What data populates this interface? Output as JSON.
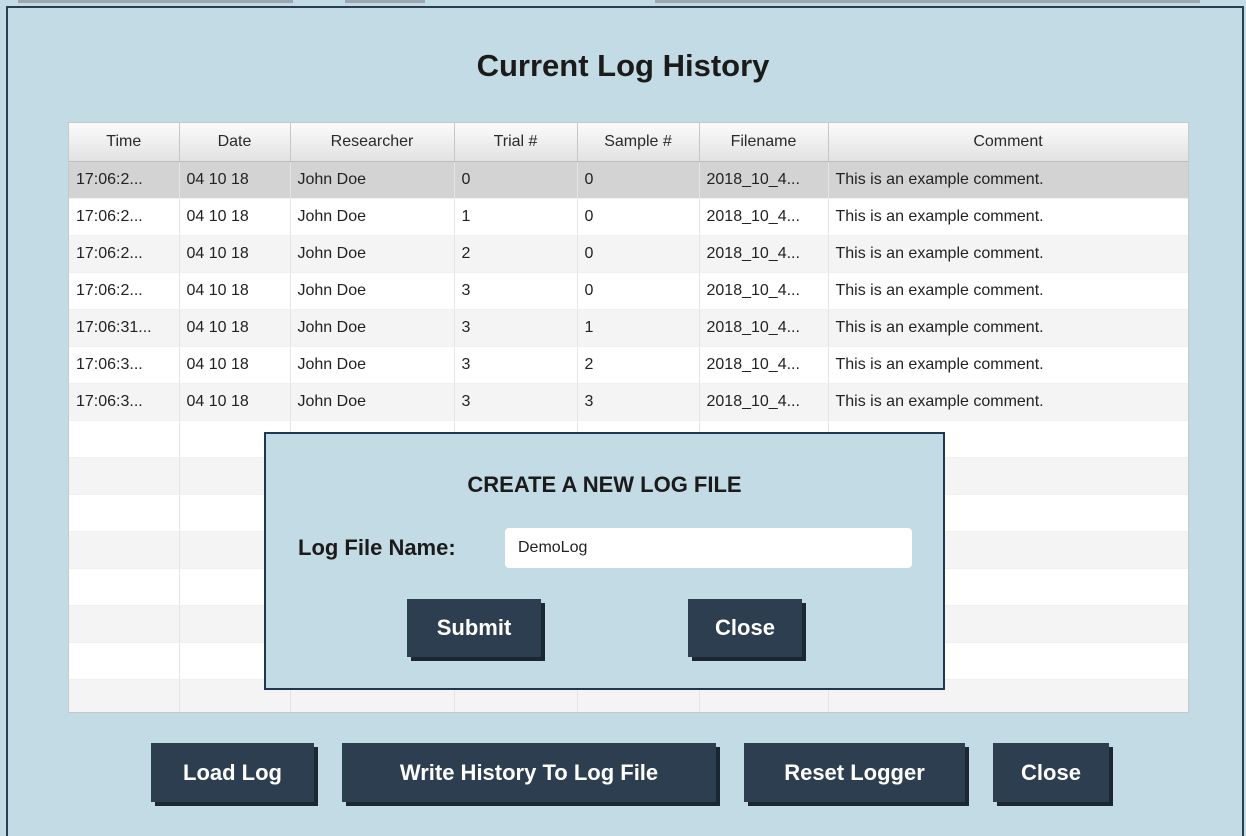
{
  "window": {
    "title": "Current Log History"
  },
  "table": {
    "columns": [
      "Time",
      "Date",
      "Researcher",
      "Trial #",
      "Sample #",
      "Filename",
      "Comment"
    ],
    "rows": [
      [
        "17:06:2...",
        "04 10 18",
        "John Doe",
        "0",
        "0",
        "2018_10_4...",
        "This is an example comment."
      ],
      [
        "17:06:2...",
        "04 10 18",
        "John Doe",
        "1",
        "0",
        "2018_10_4...",
        "This is an example comment."
      ],
      [
        "17:06:2...",
        "04 10 18",
        "John Doe",
        "2",
        "0",
        "2018_10_4...",
        "This is an example comment."
      ],
      [
        "17:06:2...",
        "04 10 18",
        "John Doe",
        "3",
        "0",
        "2018_10_4...",
        "This is an example comment."
      ],
      [
        "17:06:31...",
        "04 10 18",
        "John Doe",
        "3",
        "1",
        "2018_10_4...",
        "This is an example comment."
      ],
      [
        "17:06:3...",
        "04 10 18",
        "John Doe",
        "3",
        "2",
        "2018_10_4...",
        "This is an example comment."
      ],
      [
        "17:06:3...",
        "04 10 18",
        "John Doe",
        "3",
        "3",
        "2018_10_4...",
        "This is an example comment."
      ]
    ],
    "selected_row": 0,
    "empty_rows": 8
  },
  "dialog": {
    "title": "CREATE A NEW LOG FILE",
    "field_label": "Log File Name:",
    "field_value": "DemoLog",
    "submit_label": "Submit",
    "close_label": "Close"
  },
  "footer": {
    "load_label": "Load Log",
    "write_label": "Write History To Log File",
    "reset_label": "Reset Logger",
    "close_label": "Close"
  },
  "colors": {
    "background": "#c3dbe5",
    "button": "#2d3e50",
    "border": "#1f3750"
  }
}
